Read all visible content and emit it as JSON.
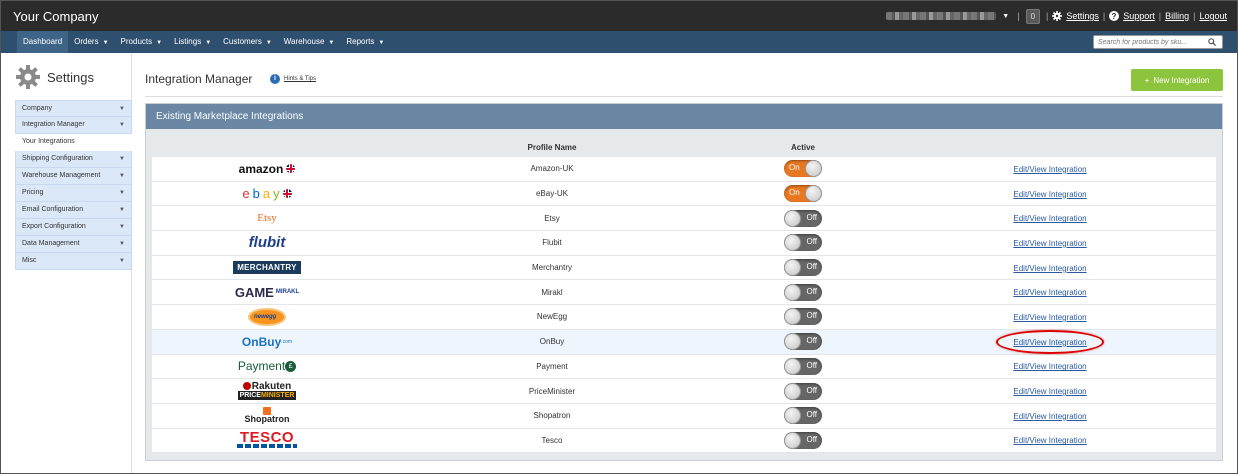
{
  "header": {
    "brand": "Your Company",
    "count": "0",
    "links": [
      "Settings",
      "Support",
      "Billing",
      "Logout"
    ]
  },
  "nav": {
    "items": [
      "Dashboard",
      "Orders",
      "Products",
      "Listings",
      "Customers",
      "Warehouse",
      "Reports"
    ],
    "search_placeholder": "Search for products by sku..."
  },
  "sidebar": {
    "title": "Settings",
    "items": [
      {
        "label": "Company",
        "has_caret": true
      },
      {
        "label": "Integration Manager",
        "has_caret": true
      },
      {
        "label": "Your Integrations",
        "has_caret": false
      },
      {
        "label": "Shipping Configuration",
        "has_caret": true
      },
      {
        "label": "Warehouse Management",
        "has_caret": true
      },
      {
        "label": "Pricing",
        "has_caret": true
      },
      {
        "label": "Email Configuration",
        "has_caret": true
      },
      {
        "label": "Export Configuration",
        "has_caret": true
      },
      {
        "label": "Data Management",
        "has_caret": true
      },
      {
        "label": "Misc",
        "has_caret": true
      }
    ]
  },
  "main": {
    "title": "Integration Manager",
    "hints": "Hints & Tips",
    "new_button": "New Integration",
    "panel_title": "Existing Marketplace Integrations",
    "columns": {
      "profile": "Profile Name",
      "active": "Active"
    },
    "rows": [
      {
        "logo": "amazon",
        "name": "Amazon-UK",
        "active": true
      },
      {
        "logo": "ebay",
        "name": "eBay-UK",
        "active": true
      },
      {
        "logo": "Etsy",
        "name": "Etsy",
        "active": false
      },
      {
        "logo": "flubit",
        "name": "Flubit",
        "active": false
      },
      {
        "logo": "MERCHANTRY",
        "name": "Merchantry",
        "active": false
      },
      {
        "logo": "GAME",
        "name": "Mirakl",
        "active": false
      },
      {
        "logo": "newegg",
        "name": "NewEgg",
        "active": false
      },
      {
        "logo": "OnBuy",
        "name": "OnBuy",
        "active": false,
        "highlight": true
      },
      {
        "logo": "Payment",
        "name": "Payment",
        "active": false
      },
      {
        "logo": "Rakuten PRICEMINISTER",
        "name": "PriceMinister",
        "active": false
      },
      {
        "logo": "Shopatron",
        "name": "Shopatron",
        "active": false
      },
      {
        "logo": "TESCO",
        "name": "Tesco",
        "active": false
      }
    ],
    "on_label": "On",
    "off_label": "Off",
    "edit_label": "Edit/View Integration"
  },
  "colors": {
    "topbar": "#2b2b2b",
    "navbar": "#2f4f6f",
    "panel_header": "#6a87a3",
    "toggle_on": "#e87722",
    "new_button": "#8dc43d"
  }
}
